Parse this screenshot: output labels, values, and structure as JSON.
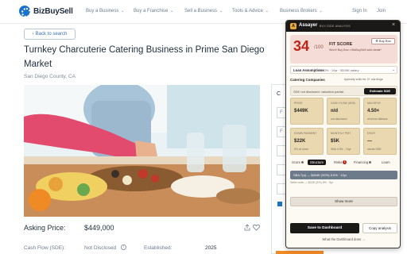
{
  "nav": {
    "brand": "BizBuySell",
    "items": [
      {
        "label": "Buy a Business",
        "chev": "⌄"
      },
      {
        "label": "Buy a Franchise",
        "chev": "⌄"
      },
      {
        "label": "Sell a Business",
        "chev": "⌄"
      },
      {
        "label": "Tools & Advice",
        "chev": "⌄"
      },
      {
        "label": "Business Brokers",
        "chev": "⌄"
      }
    ],
    "sign_in": "Sign In",
    "join": "Join"
  },
  "listing": {
    "back_label": "Back to search",
    "title": "Turnkey Charcuterie Catering Business in Prime San Diego Market",
    "location": "San Diego County, CA",
    "asking_label": "Asking Price:",
    "asking_value": "$449,000",
    "cash_flow_label": "Cash Flow (SDE):",
    "cash_flow_value": "Not Disclosed",
    "established_label": "Established:",
    "established_value": "2025"
  },
  "contact": {
    "heading": "C",
    "field_prefix": "F"
  },
  "assayer": {
    "brand": "Assayer",
    "tagline": "BUY-SIDE ANALYSIS",
    "score": "34",
    "score_den": "/100",
    "fit_label": "FIT SCORE",
    "fit_sub": "Won't Buy Box • BizBuySell sold deals*",
    "buy_box_label": "Buy Box",
    "loan_label": "Loan Assumptions",
    "loan_value": "5.50% · 10yr · $100K salary",
    "category_label": "Catering Companies",
    "category_note": "typically sells for 2+ earnings",
    "sde_note": "SDE not disclosed: valuation partial.",
    "estimate_sde_label": "Estimate SDE",
    "metrics": [
      {
        "label": "PRICE",
        "value": "$449K",
        "sub": ""
      },
      {
        "label": "CASH FLOW (SDE)",
        "value": "n/d",
        "sub": "not disclosed"
      },
      {
        "label": "MULTIPLE",
        "value": "4.50×",
        "sub": "revenue fallback"
      },
      {
        "label": "DOWN PAYMENT",
        "value": "$22K",
        "sub": "5% at close"
      },
      {
        "label": "MONTHLY PMT",
        "value": "$5K",
        "sub": "SBA 4.5% · 10yr"
      },
      {
        "label": "DSCR",
        "value": "—",
        "sub": "needs SDE"
      }
    ],
    "tabs": [
      {
        "label": "Score",
        "badge": ""
      },
      {
        "label": "Structure",
        "badge": ""
      },
      {
        "label": "Risks",
        "badge": "1"
      },
      {
        "label": "Financing",
        "badge": ""
      },
      {
        "label": "Learn",
        "badge": ""
      }
    ],
    "sba_text": "SBA 7(a) — $404K (90%) 5.5% · 10yr",
    "seller_note": "Seller note — $22K (5%) 6% · 5yr",
    "show_more_label": "Show more",
    "save_label": "Save to Dashboard",
    "copy_label": "Copy analysis",
    "dashboard_link": "What the Dashboard does →"
  }
}
